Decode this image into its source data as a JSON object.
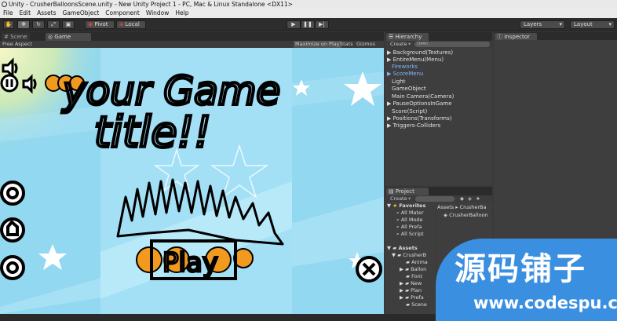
{
  "window": {
    "title": "Unity - CrusherBalloonsScene.unity - New Unity Project 1 - PC, Mac & Linux Standalone <DX11>"
  },
  "menu": [
    "File",
    "Edit",
    "Assets",
    "GameObject",
    "Component",
    "Window",
    "Help"
  ],
  "toolbar": {
    "pivot_label": "Pivot",
    "local_label": "Local",
    "layers_label": "Layers",
    "layout_label": "Layout"
  },
  "scene_panel": {
    "scene_tab": "Scene",
    "game_tab": "Game",
    "aspect_label": "Free Aspect",
    "maximize_label": "Maximize on Play",
    "stats_label": "Stats",
    "gizmos_label": "Gizmos"
  },
  "game": {
    "title_line1": "your Game",
    "title_line2": "title!!",
    "play_label": "Play"
  },
  "hierarchy": {
    "tab": "Hierarchy",
    "create_label": "Create",
    "search_placeholder": "Q▾All",
    "items": [
      {
        "label": "Background(Textures)",
        "arrow": "▶",
        "color": "normal"
      },
      {
        "label": "EntireMenu(Menu)",
        "arrow": "▶",
        "color": "normal"
      },
      {
        "label": "Fireworks",
        "arrow": "",
        "color": "blue"
      },
      {
        "label": "ScoreMenu",
        "arrow": "▶",
        "color": "blue"
      },
      {
        "label": "Light",
        "arrow": "",
        "color": "normal"
      },
      {
        "label": "GameObject",
        "arrow": "",
        "color": "normal"
      },
      {
        "label": "Main Camera(Camera)",
        "arrow": "",
        "color": "normal"
      },
      {
        "label": "PauseOptionsInGame",
        "arrow": "▶",
        "color": "normal"
      },
      {
        "label": "Score(Script)",
        "arrow": "",
        "color": "normal"
      },
      {
        "label": "Positions(Transforms)",
        "arrow": "▶",
        "color": "normal"
      },
      {
        "label": "Triggers-Colliders",
        "arrow": "▶",
        "color": "normal"
      }
    ]
  },
  "inspector": {
    "tab": "Inspector"
  },
  "project": {
    "tab": "Project",
    "create_label": "Create",
    "favorites_label": "Favorites",
    "favorites": [
      "All Mater",
      "All Mode",
      "All Prefa",
      "All Script"
    ],
    "assets_label": "Assets",
    "folders": [
      "CrusherB",
      "Anima",
      "Ballon",
      "Font",
      "New",
      "Plan",
      "Prefa",
      "Scene"
    ],
    "breadcrumb": "Assets ▸ CrusherBa",
    "asset_item": "CrusherBalloon"
  },
  "watermark": {
    "main": "源码铺子",
    "url": "www.codespu.com"
  }
}
